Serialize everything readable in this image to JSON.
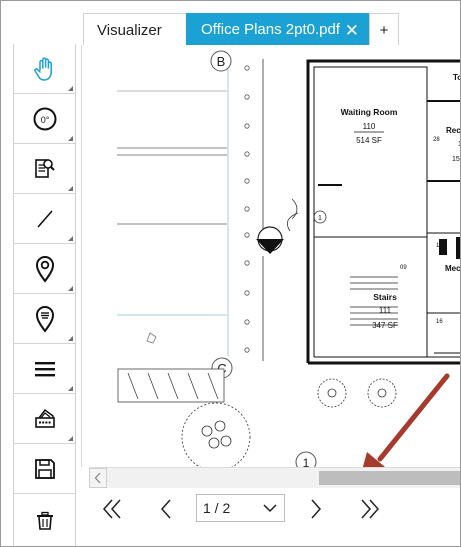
{
  "tabs": {
    "visualizer_label": "Visualizer",
    "active_label": "Office Plans 2pt0.pdf",
    "close_glyph": "✕",
    "add_glyph": "+"
  },
  "toolbar": {
    "tools": [
      {
        "name": "pan-hand-icon",
        "active": true
      },
      {
        "name": "rotate-icon",
        "label": "0°"
      },
      {
        "name": "inspect-document-icon"
      },
      {
        "name": "line-tool-icon"
      },
      {
        "name": "location-pin-icon"
      },
      {
        "name": "pin-notes-icon"
      },
      {
        "name": "layers-menu-icon"
      },
      {
        "name": "print-icon"
      },
      {
        "name": "save-icon"
      },
      {
        "name": "delete-icon"
      }
    ],
    "accent": "#1ba1d4"
  },
  "drawing": {
    "grid_markers": [
      "B",
      "C",
      "1"
    ],
    "rooms": [
      {
        "name": "Waiting Room",
        "number": "110",
        "area": "514 SF"
      },
      {
        "name": "Stairs",
        "number": "111",
        "area": "347 SF"
      },
      {
        "name": "Mec"
      },
      {
        "name": "Rece",
        "number": "1",
        "area": "15"
      },
      {
        "name": "To"
      }
    ],
    "tags": [
      "1",
      "28",
      "16",
      "19",
      "09",
      "16"
    ]
  },
  "navigation": {
    "first_glyph": "«",
    "prev_glyph": "‹",
    "page_value": "1 / 2",
    "next_glyph": "›",
    "last_glyph": "»"
  },
  "annotation": {
    "arrow_color": "#a63a2c"
  }
}
